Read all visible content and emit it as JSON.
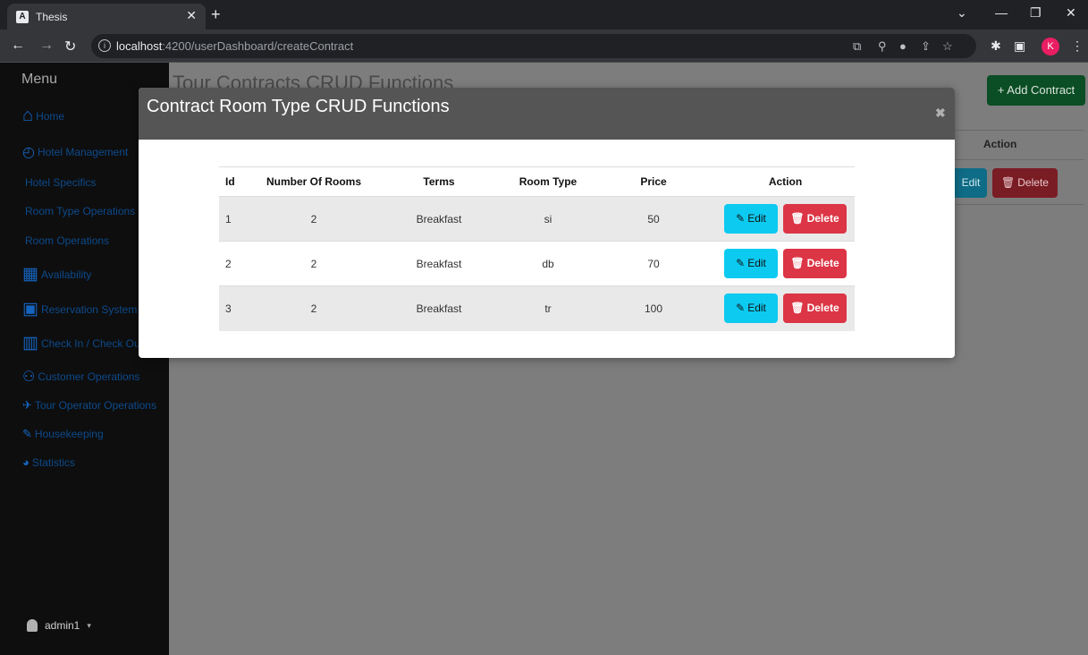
{
  "browser": {
    "tab_title": "Thesis",
    "favicon": "A",
    "url_host": "localhost",
    "url_rest": ":4200/userDashboard/createContract",
    "profile_initial": "K"
  },
  "sidebar": {
    "menu_title": "Menu",
    "items": [
      {
        "label": "Home",
        "icon": "home-icon"
      },
      {
        "label": "Hotel Management",
        "icon": "dashboard-icon"
      },
      {
        "label": "Hotel Specifics",
        "icon": ""
      },
      {
        "label": "Room Type Operations",
        "icon": ""
      },
      {
        "label": "Room Operations",
        "icon": ""
      },
      {
        "label": "Availability",
        "icon": "table-icon"
      },
      {
        "label": "Reservation System",
        "icon": "calendar-plus-icon"
      },
      {
        "label": "Check In / Check Out",
        "icon": "building-check-icon"
      },
      {
        "label": "Customer Operations",
        "icon": "people-icon"
      },
      {
        "label": "Tour Operator Operations",
        "icon": "airplane-icon"
      },
      {
        "label": "Housekeeping",
        "icon": "brush-icon"
      },
      {
        "label": "Statistics",
        "icon": "pie-chart-icon"
      }
    ],
    "user_name": "admin1"
  },
  "background_page": {
    "title": "Tour Contracts CRUD Functions",
    "add_button": "+ Add Contract",
    "action_header": "Action",
    "edit_label": "Edit",
    "delete_label": "Delete"
  },
  "modal": {
    "title": "Contract Room Type CRUD Functions",
    "close": "✖",
    "columns": [
      "Id",
      "Number Of Rooms",
      "Terms",
      "Room Type",
      "Price",
      "Action"
    ],
    "rows": [
      {
        "id": "1",
        "rooms": "2",
        "terms": "Breakfast",
        "room_type": "si",
        "price": "50"
      },
      {
        "id": "2",
        "rooms": "2",
        "terms": "Breakfast",
        "room_type": "db",
        "price": "70"
      },
      {
        "id": "3",
        "rooms": "2",
        "terms": "Breakfast",
        "room_type": "tr",
        "price": "100"
      }
    ],
    "edit_label": "Edit",
    "delete_label": "Delete"
  },
  "colors": {
    "edit": "#0dcaf0",
    "delete": "#dc3545",
    "modal_header": "#555555",
    "sidebar": "#0e0e0f",
    "sidebar_link": "#0d4a8a"
  }
}
